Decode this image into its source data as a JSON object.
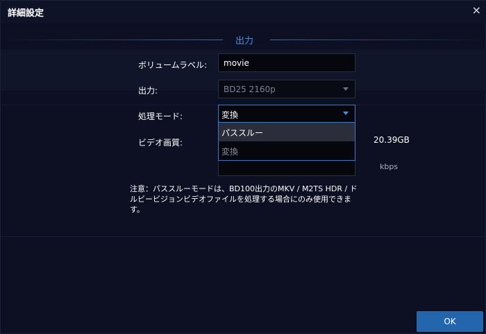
{
  "window": {
    "title": "詳細設定",
    "close_glyph": "×"
  },
  "section": {
    "title": "出力"
  },
  "fields": {
    "volume_label": {
      "label": "ボリュームラベル:",
      "value": "movie"
    },
    "output": {
      "label": "出力:",
      "value": "BD25 2160p"
    },
    "processing_mode": {
      "label": "処理モード:",
      "value": "変換",
      "options": [
        "パススルー",
        "変換"
      ]
    },
    "video_quality": {
      "label": "ビデオ画質:"
    }
  },
  "size": {
    "value": "20.39GB"
  },
  "bitrate": {
    "unit": "kbps"
  },
  "note": "注意：パススルーモードは、BD100出力のMKV / M2TS HDR / ドルビービジョンビデオファイルを処理する場合にのみ使用できます。",
  "buttons": {
    "ok": "OK"
  },
  "colors": {
    "accent": "#4a90e2",
    "button": "#2466ad",
    "background": "#0d1022"
  }
}
